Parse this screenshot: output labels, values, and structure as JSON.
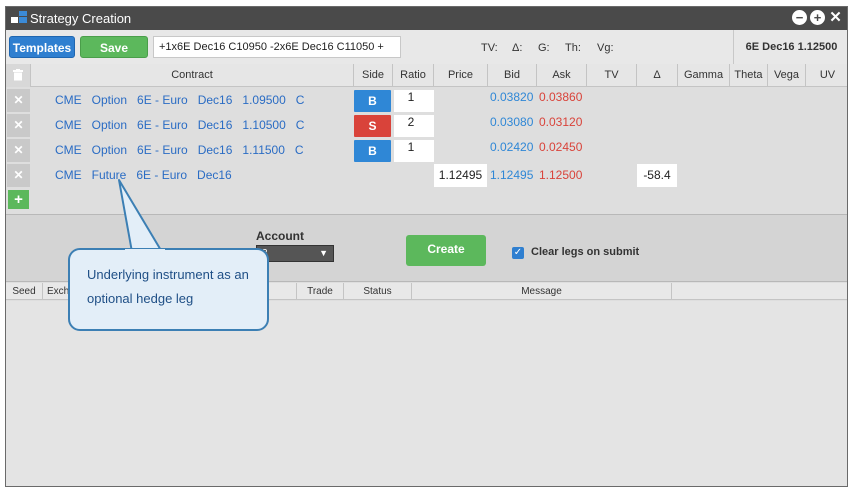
{
  "window": {
    "title": "Strategy Creation"
  },
  "toolbar": {
    "templates_label": "Templates",
    "save_label": "Save",
    "strategy_text": "+1x6E Dec16 C10950 -2x6E Dec16 C11050 +",
    "greeks": {
      "tv": "TV:",
      "delta": "Δ:",
      "gamma": "G:",
      "theta": "Th:",
      "vega": "Vg:"
    },
    "instrument": "6E Dec16  1.12500"
  },
  "grid": {
    "headers": {
      "contract": "Contract",
      "side": "Side",
      "ratio": "Ratio",
      "price": "Price",
      "bid": "Bid",
      "ask": "Ask",
      "tv": "TV",
      "delta": "Δ",
      "gamma": "Gamma",
      "theta": "Theta",
      "vega": "Vega",
      "uv": "UV"
    },
    "rows": [
      {
        "contract": "CME   Option   6E - Euro   Dec16   1.09500   C",
        "side": "B",
        "ratio": "1",
        "price": "",
        "bid": "0.03820",
        "ask": "0.03860",
        "delta": ""
      },
      {
        "contract": "CME   Option   6E - Euro   Dec16   1.10500   C",
        "side": "S",
        "ratio": "2",
        "price": "",
        "bid": "0.03080",
        "ask": "0.03120",
        "delta": ""
      },
      {
        "contract": "CME   Option   6E - Euro   Dec16   1.11500   C",
        "side": "B",
        "ratio": "1",
        "price": "",
        "bid": "0.02420",
        "ask": "0.02450",
        "delta": ""
      },
      {
        "contract": "CME   Future   6E - Euro   Dec16",
        "side": "",
        "ratio": "",
        "price": "1.12495",
        "bid": "1.12495",
        "ask": "1.12500",
        "delta": "-58.4"
      }
    ]
  },
  "create_panel": {
    "account_label": "Account",
    "account_value": "3",
    "create_label": "Create",
    "clear_legs_label": "Clear legs on submit"
  },
  "orders": {
    "headers": {
      "seed": "Seed",
      "exch": "Exch",
      "trade": "Trade",
      "status": "Status",
      "message": "Message"
    }
  },
  "callout": {
    "text": "Underlying instrument as an optional hedge leg"
  },
  "colors": {
    "accent_blue": "#2f7fd0",
    "buy": "#2f87d6",
    "sell": "#d9433a",
    "green": "#5cb85c",
    "title_bar": "#4a4a4a"
  }
}
